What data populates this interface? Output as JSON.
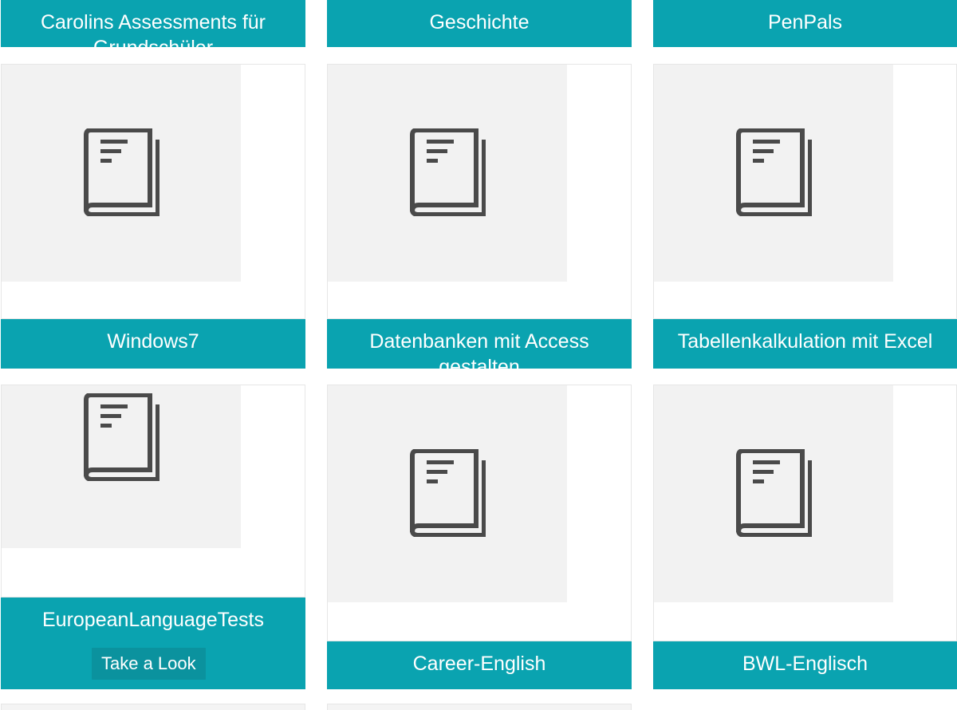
{
  "colors": {
    "accent": "#0aa3b0",
    "button": "#0b929e",
    "thumb_bg": "#f2f2f2",
    "icon": "#4a4a4a"
  },
  "rows": [
    {
      "titles": [
        "Carolins Assessments für Grundschüler",
        "Geschichte",
        "PenPals"
      ]
    },
    {
      "titles": [
        "Windows7",
        "Datenbanken mit Access gestalten",
        "Tabellenkalkulation mit Excel"
      ]
    },
    {
      "titles": [
        "EuropeanLanguageTests",
        "Career-English",
        "BWL-Englisch"
      ]
    }
  ],
  "cards": {
    "take_look_label": "Take a Look"
  },
  "icons": {
    "course": "book-icon"
  }
}
